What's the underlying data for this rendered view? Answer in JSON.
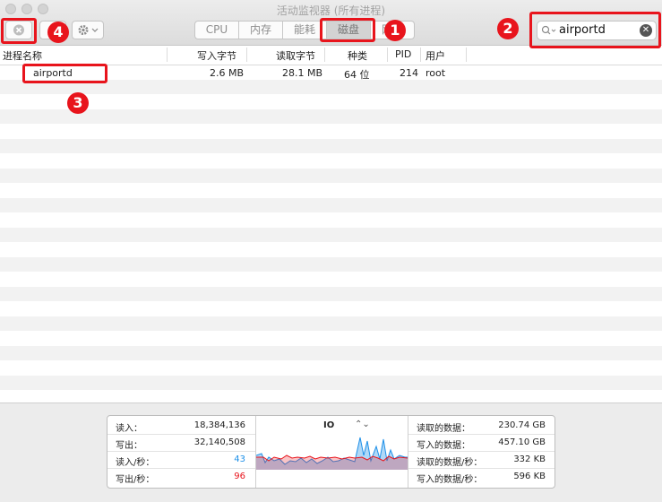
{
  "window": {
    "title": "活动监视器 (所有进程)"
  },
  "toolbar": {
    "tabs": [
      {
        "label": "CPU",
        "active": false
      },
      {
        "label": "内存",
        "active": false
      },
      {
        "label": "能耗",
        "active": false
      },
      {
        "label": "磁盘",
        "active": true
      },
      {
        "label": "网络",
        "active": false
      }
    ],
    "search_value": "airportd"
  },
  "annotations": [
    "1",
    "2",
    "3",
    "4"
  ],
  "table": {
    "columns": [
      "进程名称",
      "写入字节",
      "读取字节",
      "种类",
      "PID",
      "用户"
    ],
    "rows": [
      {
        "name": "airportd",
        "written": "2.6 MB",
        "read": "28.1 MB",
        "kind": "64 位",
        "pid": "214",
        "user": "root"
      }
    ]
  },
  "stats": {
    "reads_in": {
      "label": "读入：",
      "value": "18,384,136"
    },
    "writes_out": {
      "label": "写出：",
      "value": "32,140,508"
    },
    "reads_per_sec": {
      "label": "读入/秒：",
      "value": "43"
    },
    "writes_per_sec": {
      "label": "写出/秒：",
      "value": "96"
    },
    "graph_label": "IO",
    "data_read": {
      "label": "读取的数据：",
      "value": "230.74 GB"
    },
    "data_written": {
      "label": "写入的数据：",
      "value": "457.10 GB"
    },
    "data_read_per_sec": {
      "label": "读取的数据/秒：",
      "value": "332 KB"
    },
    "data_written_per_sec": {
      "label": "写入的数据/秒：",
      "value": "596 KB"
    }
  },
  "colors": {
    "annotation": "#e8141c",
    "read": "#1e90e8",
    "write": "#e8141c"
  }
}
